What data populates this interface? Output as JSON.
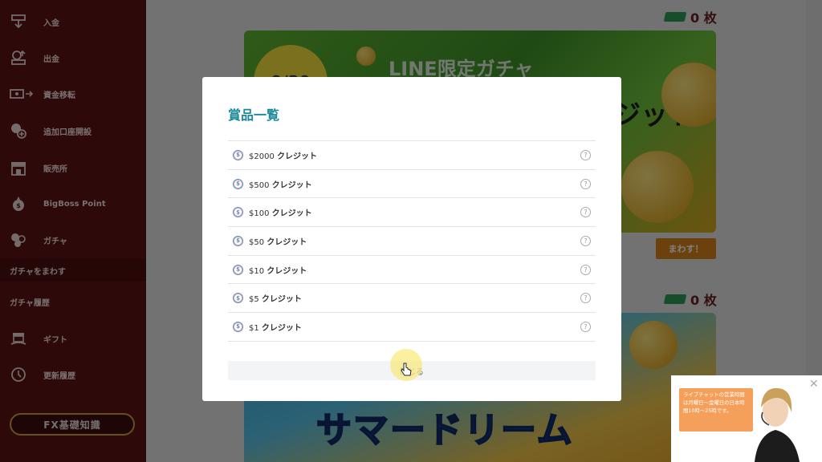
{
  "sidebar": {
    "items": [
      {
        "label": "入金",
        "icon": "deposit-icon"
      },
      {
        "label": "出金",
        "icon": "withdraw-icon"
      },
      {
        "label": "資金移転",
        "icon": "transfer-icon"
      },
      {
        "label": "追加口座開設",
        "icon": "add-account-icon"
      },
      {
        "label": "販売所",
        "icon": "store-icon"
      },
      {
        "label": "BigBoss Point",
        "icon": "point-icon"
      },
      {
        "label": "ガチャ",
        "icon": "gacha-icon"
      }
    ],
    "sub_items": [
      {
        "label": "ガチャをまわす",
        "active": true
      },
      {
        "label": "ガチャ履歴",
        "active": false
      }
    ],
    "items_lower": [
      {
        "label": "ギフト",
        "icon": "gift-icon"
      },
      {
        "label": "更新履歴",
        "icon": "history-icon"
      }
    ],
    "fx_button": "FX基礎知識"
  },
  "main": {
    "ticket_count_1": "0 枚",
    "ticket_count_2": "0 枚",
    "banner1": {
      "burst": "9/30",
      "title": "LINE限定ガチャ",
      "subtitle": "ジット"
    },
    "spin_button": "まわす！",
    "banner2": {
      "title": "サマードリーム"
    }
  },
  "modal": {
    "title": "賞品一覧",
    "prizes": [
      {
        "amount": "$2000",
        "unit": "クレジット"
      },
      {
        "amount": "$500",
        "unit": "クレジット"
      },
      {
        "amount": "$100",
        "unit": "クレジット"
      },
      {
        "amount": "$50",
        "unit": "クレジット"
      },
      {
        "amount": "$10",
        "unit": "クレジット"
      },
      {
        "amount": "$5",
        "unit": "クレジット"
      },
      {
        "amount": "$1",
        "unit": "クレジット"
      }
    ],
    "help_glyph": "?",
    "coin_glyph": "$",
    "close_label": "閉じる"
  },
  "chat": {
    "message": "ライブチャットの営業時間は月曜日～金曜日の日本時間10時～25時です。",
    "close_glyph": "✕"
  },
  "colors": {
    "sidebar": "#5a1212",
    "accent_teal": "#1a8a9a",
    "spin_orange": "#d9821c",
    "ticket_green": "#2f9a57"
  }
}
